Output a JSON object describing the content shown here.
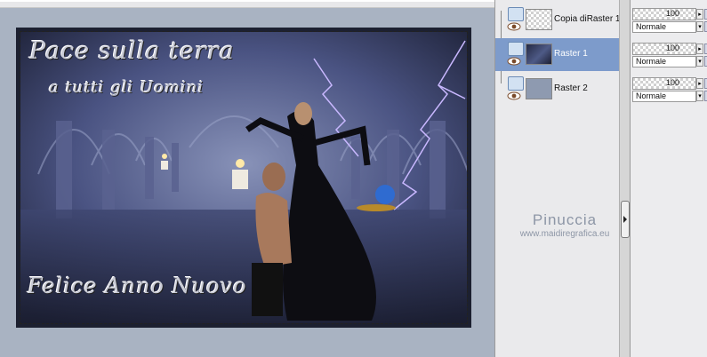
{
  "artwork": {
    "title_line1": "Pace sulla terra",
    "title_line2": "a tutti gli Uomini",
    "greeting": "Felice Anno Nuovo"
  },
  "layers": [
    {
      "name": "Copia diRaster 1",
      "thumbnail": "checker",
      "visible": true,
      "active": false
    },
    {
      "name": "Raster 1",
      "thumbnail": "image",
      "visible": true,
      "active": true
    },
    {
      "name": "Raster 2",
      "thumbnail": "gray",
      "visible": true,
      "active": false
    }
  ],
  "properties": [
    {
      "opacity": "100",
      "blend_mode": "Normale"
    },
    {
      "opacity": "100",
      "blend_mode": "Normale"
    },
    {
      "opacity": "100",
      "blend_mode": "Normale"
    }
  ],
  "watermark": {
    "name": "Pinuccia",
    "url": "www.maidiregrafica.eu"
  },
  "colors": {
    "canvas_bg": "#a9b3c2",
    "active_layer": "#7d9bcb",
    "panel_bg": "#eaeaec"
  }
}
